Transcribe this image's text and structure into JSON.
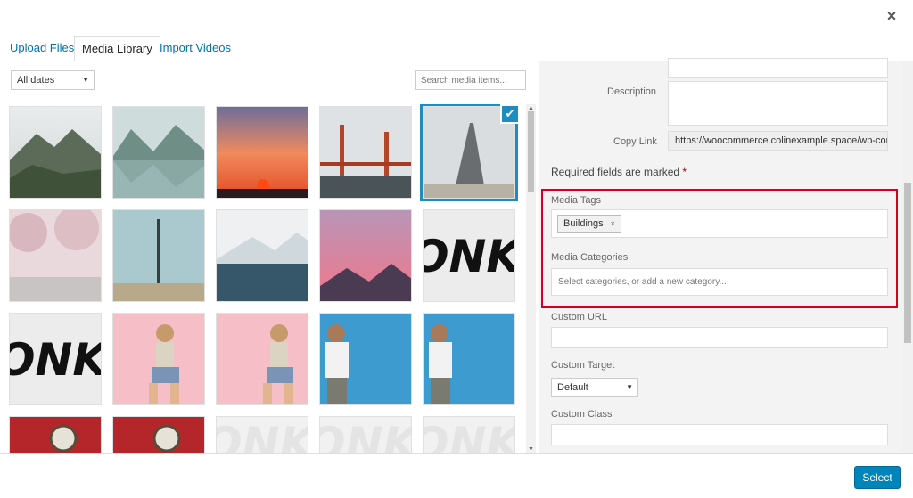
{
  "header": {
    "close_icon": "×",
    "tabs": [
      {
        "label": "Upload Files"
      },
      {
        "label": "Media Library"
      },
      {
        "label": "Import Videos"
      }
    ]
  },
  "toolbar": {
    "date_filter": "All dates",
    "search_placeholder": "Search media items..."
  },
  "grid": {
    "items": [
      {
        "desc": "mountain-ruins"
      },
      {
        "desc": "mountain-lake"
      },
      {
        "desc": "sunset"
      },
      {
        "desc": "golden-gate-bridge"
      },
      {
        "desc": "eiffel-tower",
        "selected": true
      },
      {
        "desc": "cherry-blossom"
      },
      {
        "desc": "signpost"
      },
      {
        "desc": "glacier-coast"
      },
      {
        "desc": "pink-sky-mountains"
      },
      {
        "desc": "onk-logo",
        "text": "ONK"
      },
      {
        "desc": "onk-logo",
        "text": "ONK"
      },
      {
        "desc": "woman-pink"
      },
      {
        "desc": "woman-pink"
      },
      {
        "desc": "man-blue-wall"
      },
      {
        "desc": "man-blue-wall"
      },
      {
        "desc": "watch-red"
      },
      {
        "desc": "watch-red"
      },
      {
        "desc": "onk-faded",
        "text": "ONK"
      },
      {
        "desc": "onk-faded",
        "text": "ONK"
      },
      {
        "desc": "onk-faded",
        "text": "ONK"
      }
    ]
  },
  "sidebar": {
    "description_label": "Description",
    "copy_link_label": "Copy Link",
    "copy_link_value": "https://woocommerce.colinexample.space/wp-conte",
    "required_text": "Required fields are marked",
    "required_star": "*",
    "media_tags_label": "Media Tags",
    "tag": "Buildings",
    "tag_remove": "×",
    "media_categories_label": "Media Categories",
    "categories_placeholder": "Select categories, or add a new category...",
    "custom_url_label": "Custom URL",
    "custom_target_label": "Custom Target",
    "custom_target_value": "Default",
    "custom_class_label": "Custom Class"
  },
  "footer": {
    "select_label": "Select"
  },
  "colors": {
    "accent": "#0073aa",
    "button": "#0085ba",
    "highlight": "#d6001c"
  }
}
